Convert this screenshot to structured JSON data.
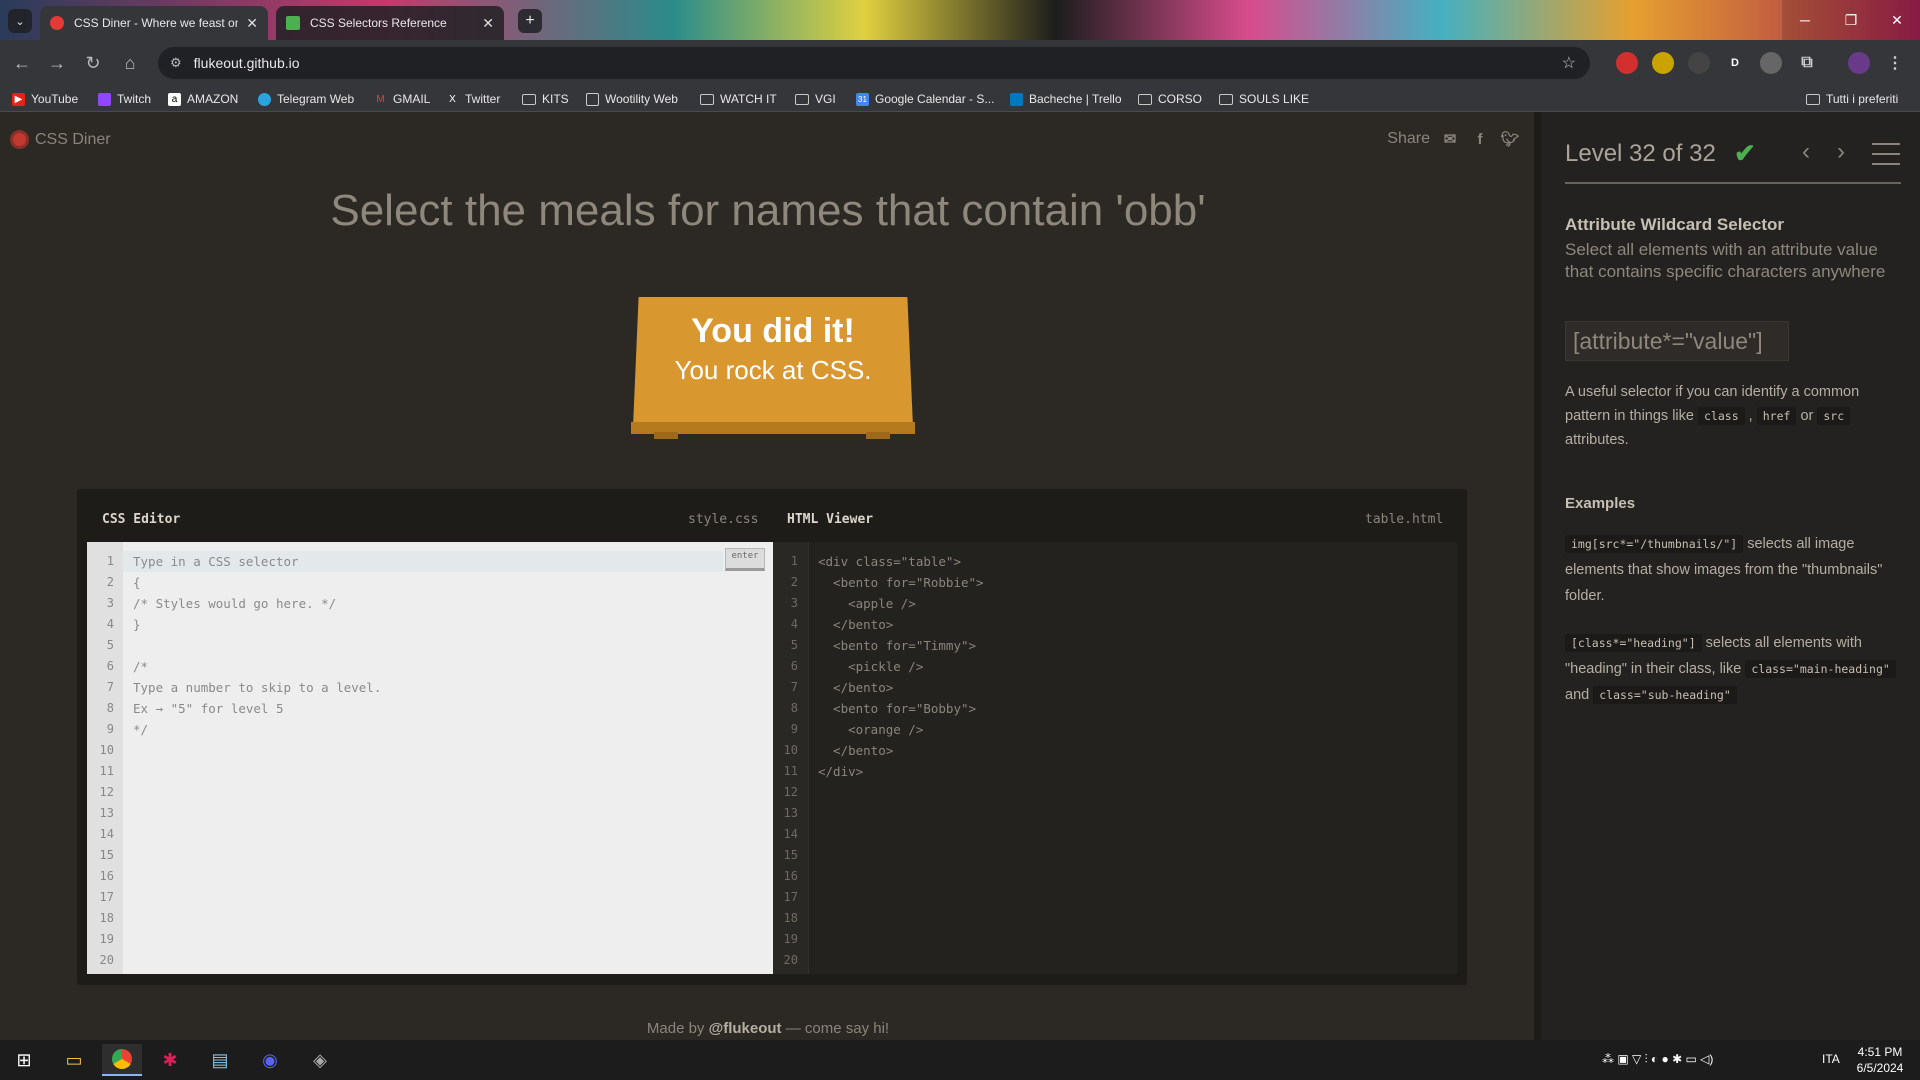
{
  "browser": {
    "tabs": [
      {
        "title": "CSS Diner - Where we feast on",
        "active": true
      },
      {
        "title": "CSS Selectors Reference",
        "active": false
      }
    ],
    "url": "flukeout.github.io",
    "extensions": [
      "D"
    ],
    "bookmarks": [
      "YouTube",
      "Twitch",
      "AMAZON",
      "Telegram Web",
      "GMAIL",
      "Twitter",
      "KITS",
      "Wootility Web",
      "WATCH IT",
      "VGI",
      "Google Calendar - S...",
      "Bacheche | Trello",
      "CORSO",
      "SOULS LIKE"
    ],
    "all_bookmarks": "Tutti i preferiti"
  },
  "game": {
    "logo": "CSS Diner",
    "share_label": "Share",
    "instruction": "Select the meals for names that contain 'obb'",
    "win_line1": "You did it!",
    "win_line2": "You rock at CSS.",
    "css_editor": {
      "title": "CSS Editor",
      "file": "style.css",
      "enter_label": "enter",
      "lines": [
        "Type in a CSS selector",
        "{",
        "/* Styles would go here. */",
        "}",
        "",
        "/*",
        "Type a number to skip to a level.",
        "Ex → \"5\" for level 5",
        "*/"
      ]
    },
    "html_viewer": {
      "title": "HTML Viewer",
      "file": "table.html",
      "lines": [
        "<div class=\"table\">",
        "  <bento for=\"Robbie\">",
        "    <apple />",
        "  </bento>",
        "  <bento for=\"Timmy\">",
        "    <pickle />",
        "  </bento>",
        "  <bento for=\"Bobby\">",
        "    <orange />",
        "  </bento>",
        "</div>"
      ]
    },
    "line_numbers": [
      "1",
      "2",
      "3",
      "4",
      "5",
      "6",
      "7",
      "8",
      "9",
      "10",
      "11",
      "12",
      "13",
      "14",
      "15",
      "16",
      "17",
      "18",
      "19",
      "20"
    ],
    "footer_prefix": "Made by ",
    "footer_author": "@flukeout",
    "footer_suffix": " — come say hi!"
  },
  "sidebar": {
    "level": "Level 32 of 32",
    "progress": 1.0,
    "selector_name": "Attribute Wildcard Selector",
    "selector_desc": "Select all elements with an attribute value that contains specific characters anywhere",
    "syntax": "[attribute*=\"value\"]",
    "hint_prefix": "A useful selector if you can identify a common pattern in things like ",
    "hint_code1": "class",
    "hint_sep": " , ",
    "hint_code2": "href",
    "hint_or": " or ",
    "hint_code3": "src",
    "hint_suffix": " attributes.",
    "examples_heading": "Examples",
    "example1_code": "img[src*=\"/thumbnails/\"]",
    "example1_text": " selects all image elements that show images from the \"thumbnails\" folder.",
    "example2_code": "[class*=\"heading\"]",
    "example2_text": " selects all elements with \"heading\" in their class, like ",
    "example2_code2": "class=\"main-heading\"",
    "example2_and": " and ",
    "example2_code3": "class=\"sub-heading\""
  },
  "taskbar": {
    "language": "ITA",
    "time": "4:51 PM",
    "date": "6/5/2024"
  }
}
